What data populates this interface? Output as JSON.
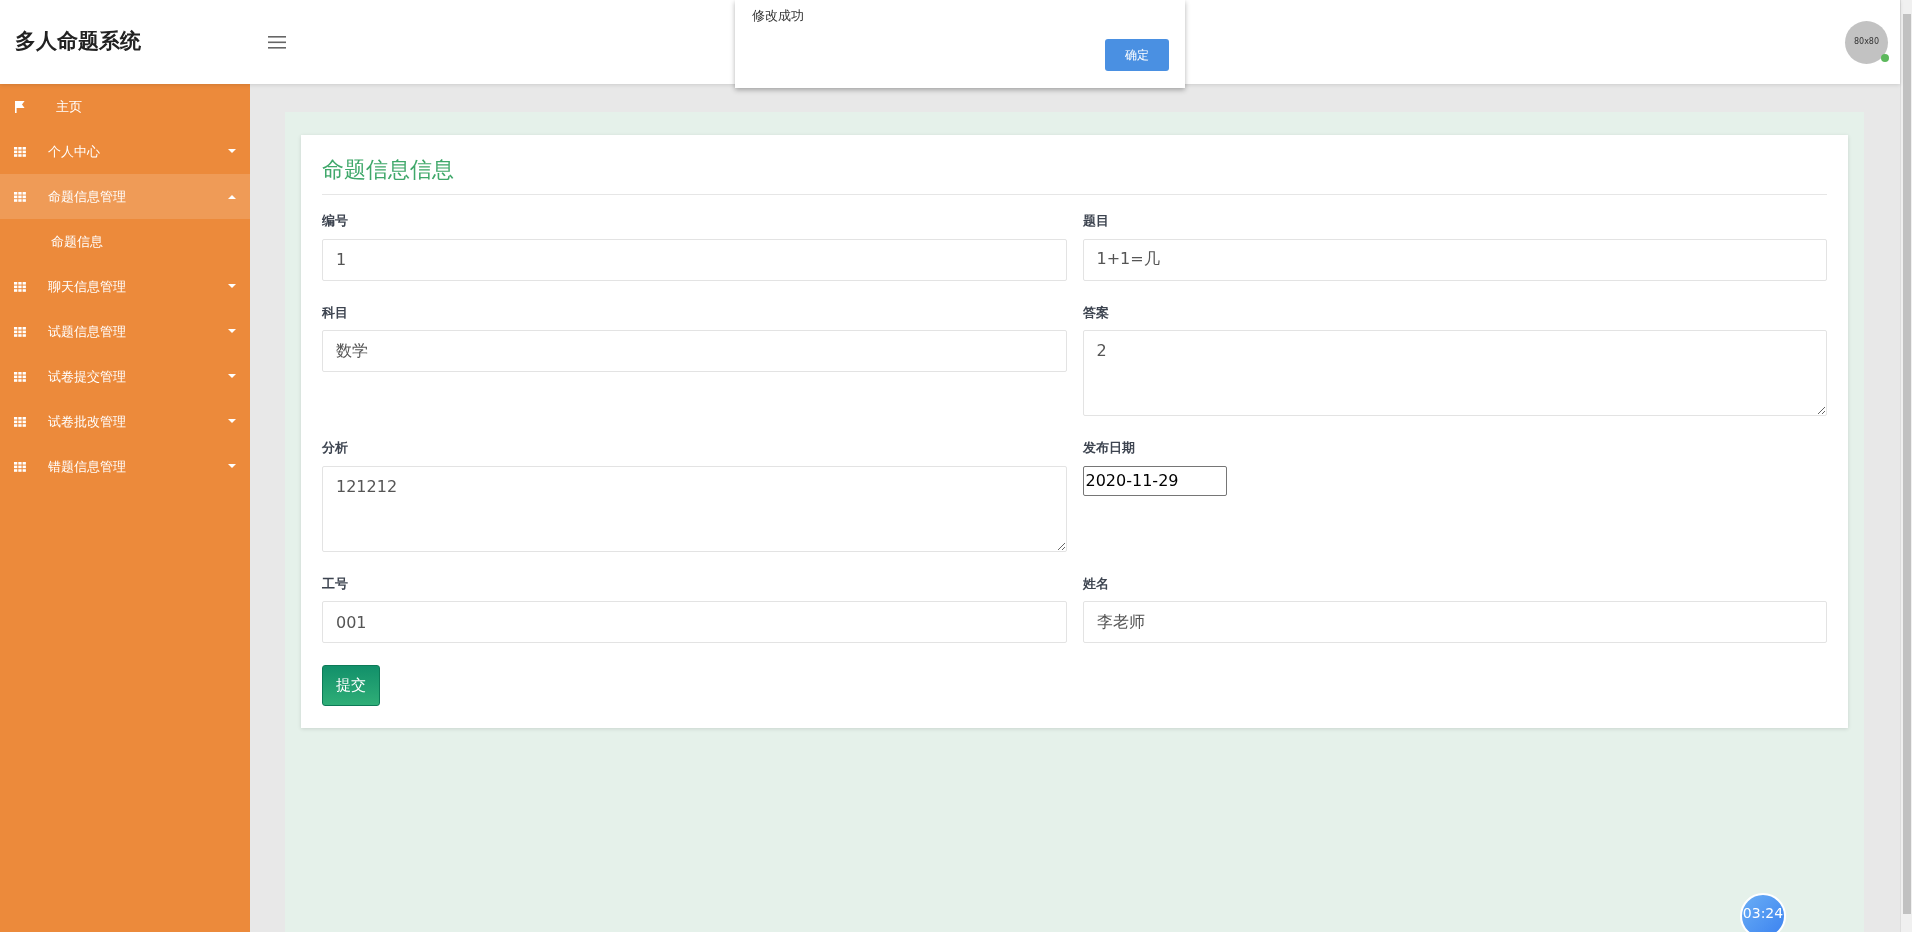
{
  "header": {
    "title": "多人命题系统",
    "avatar_text": "80x80",
    "online": true
  },
  "sidebar": {
    "items": [
      {
        "kind": "home",
        "label": "主页",
        "selected": false
      },
      {
        "kind": "group",
        "label": "个人中心",
        "expanded": false,
        "selected": false
      },
      {
        "kind": "group",
        "label": "命题信息管理",
        "expanded": true,
        "selected": true,
        "children": [
          {
            "label": "命题信息"
          }
        ]
      },
      {
        "kind": "group",
        "label": "聊天信息管理",
        "expanded": false,
        "selected": false
      },
      {
        "kind": "group",
        "label": "试题信息管理",
        "expanded": false,
        "selected": false
      },
      {
        "kind": "group",
        "label": "试卷提交管理",
        "expanded": false,
        "selected": false
      },
      {
        "kind": "group",
        "label": "试卷批改管理",
        "expanded": false,
        "selected": false
      },
      {
        "kind": "group",
        "label": "错题信息管理",
        "expanded": false,
        "selected": false
      }
    ]
  },
  "form": {
    "title": "命题信息信息",
    "fields": [
      {
        "kind": "input",
        "label": "编号",
        "value": "1"
      },
      {
        "kind": "input",
        "label": "题目",
        "value": "1+1=几"
      },
      {
        "kind": "input",
        "label": "科目",
        "value": "数学"
      },
      {
        "kind": "textarea",
        "label": "答案",
        "value": "2"
      },
      {
        "kind": "textarea",
        "label": "分析",
        "value": "121212"
      },
      {
        "kind": "date",
        "label": "发布日期",
        "value": "2020-11-29"
      },
      {
        "kind": "input",
        "label": "工号",
        "value": "001"
      },
      {
        "kind": "input",
        "label": "姓名",
        "value": "李老师"
      }
    ],
    "submit": "提交"
  },
  "dialog": {
    "message": "修改成功",
    "button": "确定"
  },
  "timer": "03:24"
}
